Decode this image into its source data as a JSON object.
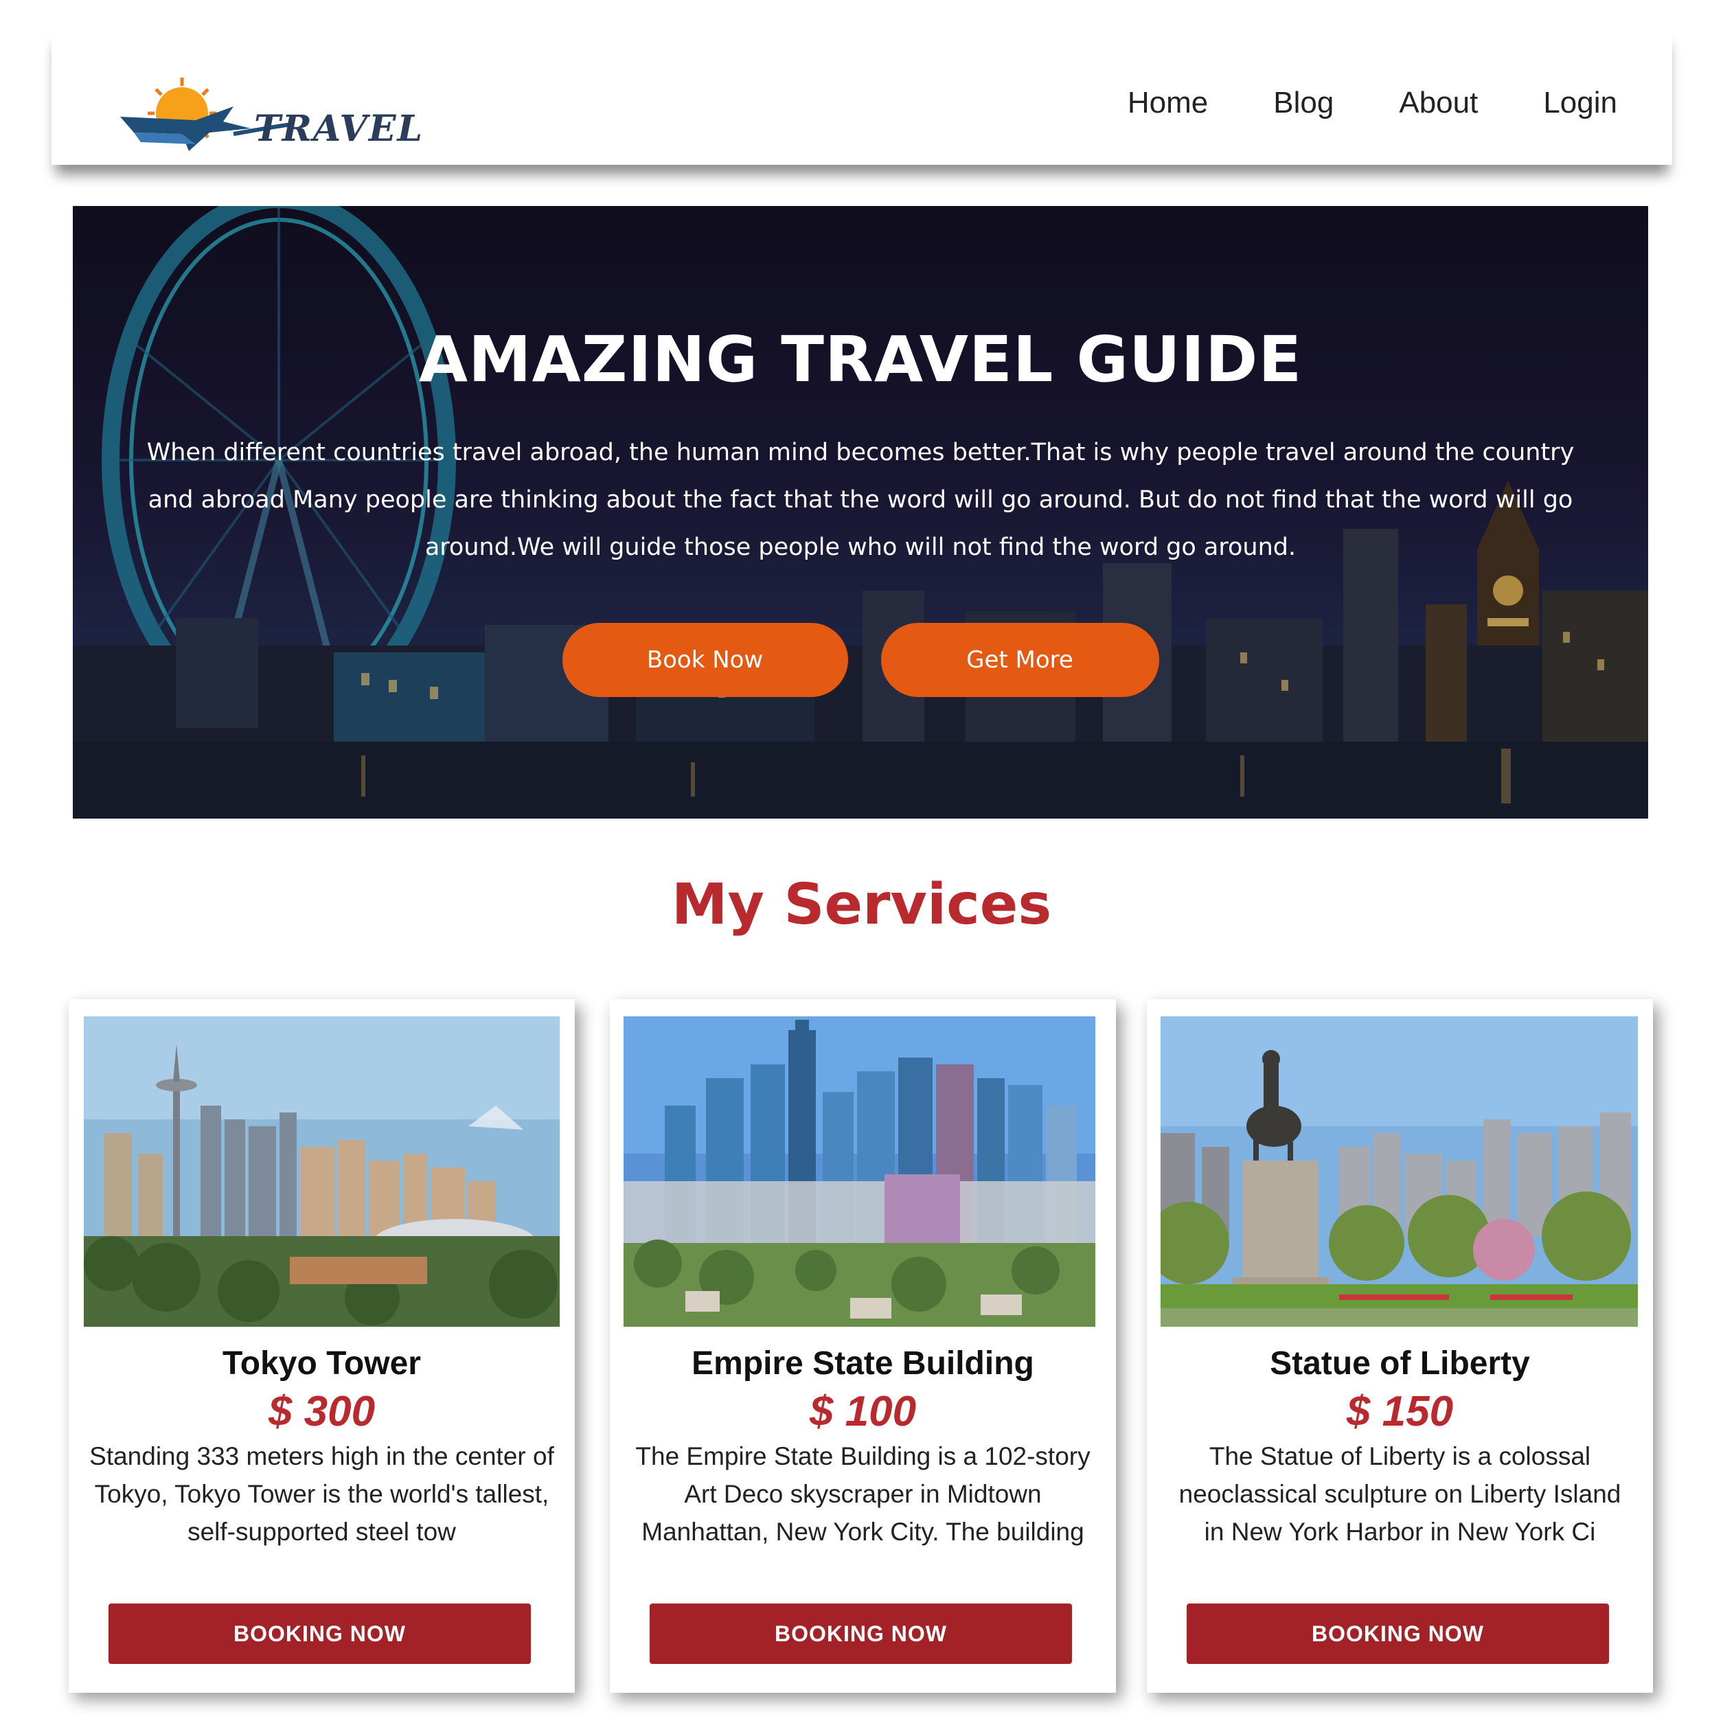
{
  "brand": {
    "logo_text": "TRAVEL"
  },
  "nav": {
    "items": [
      {
        "label": "Home"
      },
      {
        "label": "Blog"
      },
      {
        "label": "About"
      },
      {
        "label": "Login"
      }
    ]
  },
  "hero": {
    "title": "AMAZING TRAVEL GUIDE",
    "text": "When different countries travel abroad, the human mind becomes better.That is why people travel around the country and abroad Many people are thinking about the fact that the word will go around. But do not find that the word will go around.We will guide those people who will not find the word go around.",
    "book_label": "Book Now",
    "more_label": "Get More"
  },
  "services": {
    "title": "My Services",
    "cards": [
      {
        "title": "Tokyo Tower",
        "price": "$ 300",
        "description": "Standing 333 meters high in the center of Tokyo, Tokyo Tower is the world's tallest, self-supported steel tow",
        "button_label": "BOOKING NOW"
      },
      {
        "title": "Empire State Building",
        "price": "$ 100",
        "description": "The Empire State Building is a 102-story Art Deco skyscraper in Midtown Manhattan, New York City. The building",
        "button_label": "BOOKING NOW"
      },
      {
        "title": "Statue of Liberty",
        "price": "$ 150",
        "description": "The Statue of Liberty is a colossal neoclassical sculpture on Liberty Island in New York Harbor in New York Ci",
        "button_label": "BOOKING NOW"
      }
    ]
  },
  "colors": {
    "accent_orange": "#e45a12",
    "accent_red": "#b82a2e",
    "button_red": "#a32227"
  }
}
